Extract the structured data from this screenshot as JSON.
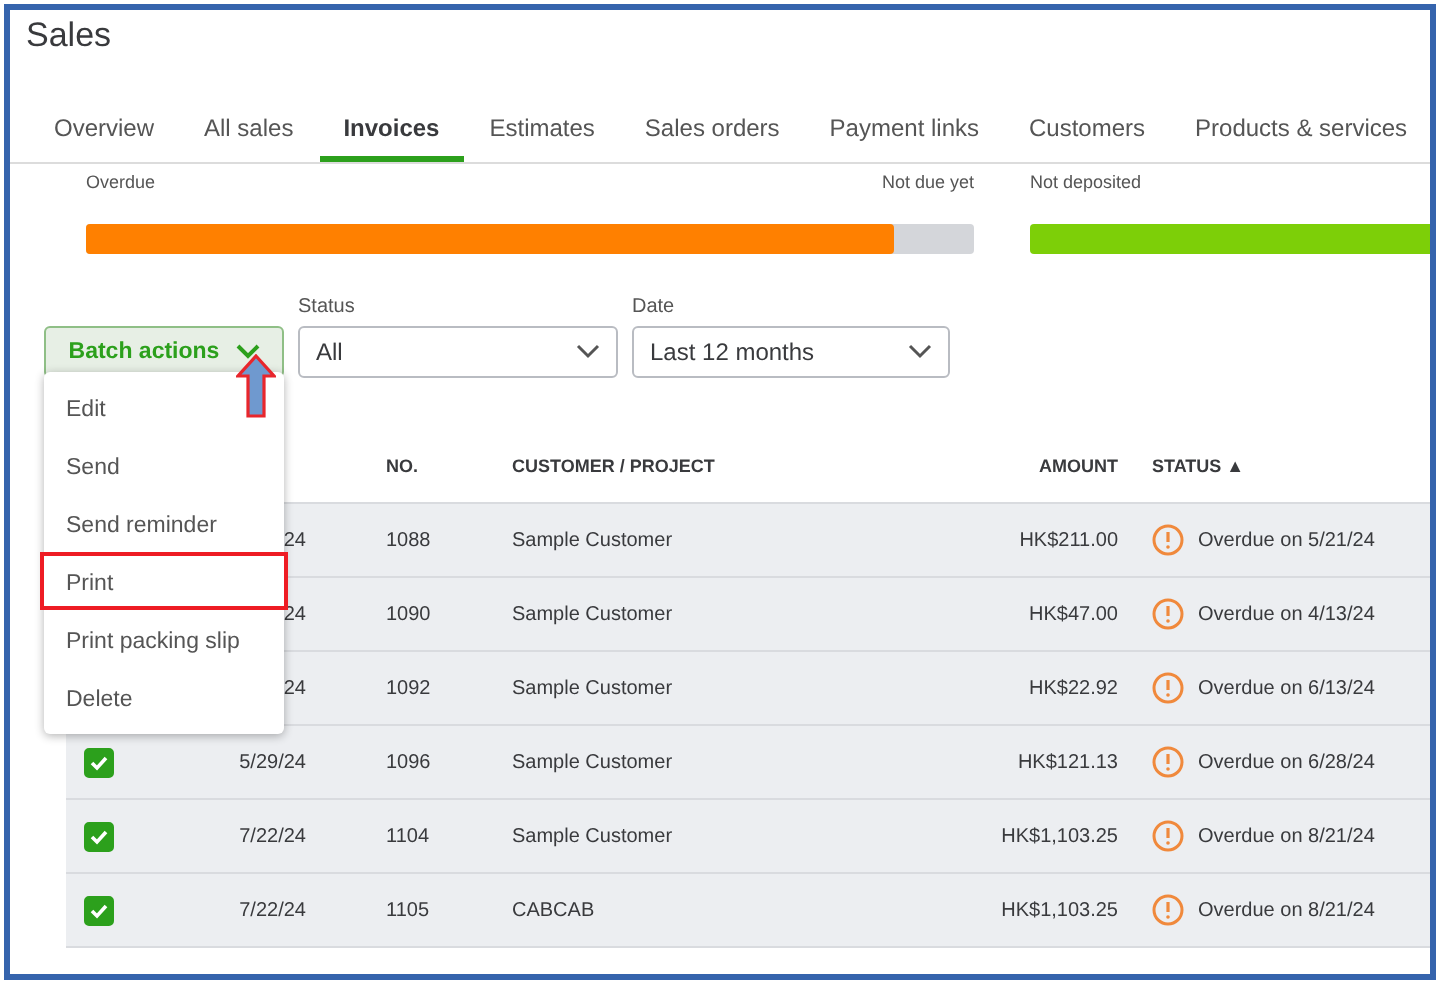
{
  "page_title": "Sales",
  "tabs": [
    {
      "label": "Overview",
      "selected": false
    },
    {
      "label": "All sales",
      "selected": false
    },
    {
      "label": "Invoices",
      "selected": true
    },
    {
      "label": "Estimates",
      "selected": false
    },
    {
      "label": "Sales orders",
      "selected": false
    },
    {
      "label": "Payment links",
      "selected": false
    },
    {
      "label": "Customers",
      "selected": false
    },
    {
      "label": "Products & services",
      "selected": false
    }
  ],
  "summary": {
    "overdue_label": "Overdue",
    "not_due_label": "Not due yet",
    "not_deposited_label": "Not deposited",
    "level": 0.91
  },
  "batch_button": {
    "label": "Batch actions",
    "pointed_at": true
  },
  "filters": [
    {
      "label": "Status",
      "value": "All"
    },
    {
      "label": "Date",
      "value": "Last 12 months"
    }
  ],
  "batch_menu": [
    {
      "label": "Edit",
      "highlighted": false
    },
    {
      "label": "Send",
      "highlighted": false
    },
    {
      "label": "Send reminder",
      "highlighted": false
    },
    {
      "label": "Print",
      "highlighted": true
    },
    {
      "label": "Print packing slip",
      "highlighted": false
    },
    {
      "label": "Delete",
      "highlighted": false
    }
  ],
  "table": {
    "columns": [
      "NO.",
      "CUSTOMER / PROJECT",
      "AMOUNT",
      "STATUS ▲"
    ],
    "rows": [
      {
        "date": "24",
        "no": "1088",
        "customer": "Sample Customer",
        "amount": "HK$211.00",
        "status": "Overdue on 5/21/24"
      },
      {
        "date": "24",
        "no": "1090",
        "customer": "Sample Customer",
        "amount": "HK$47.00",
        "status": "Overdue on 4/13/24"
      },
      {
        "date": "24",
        "no": "1092",
        "customer": "Sample Customer",
        "amount": "HK$22.92",
        "status": "Overdue on 6/13/24"
      },
      {
        "checked": true,
        "date": "5/29/24",
        "no": "1096",
        "customer": "Sample Customer",
        "amount": "HK$121.13",
        "status": "Overdue on 6/28/24"
      },
      {
        "checked": true,
        "date": "7/22/24",
        "no": "1104",
        "customer": "Sample Customer",
        "amount": "HK$1,103.25",
        "status": "Overdue on 8/21/24"
      },
      {
        "checked": true,
        "date": "7/22/24",
        "no": "1105",
        "customer": "CABCAB",
        "amount": "HK$1,103.25",
        "status": "Overdue on 8/21/24"
      }
    ]
  }
}
